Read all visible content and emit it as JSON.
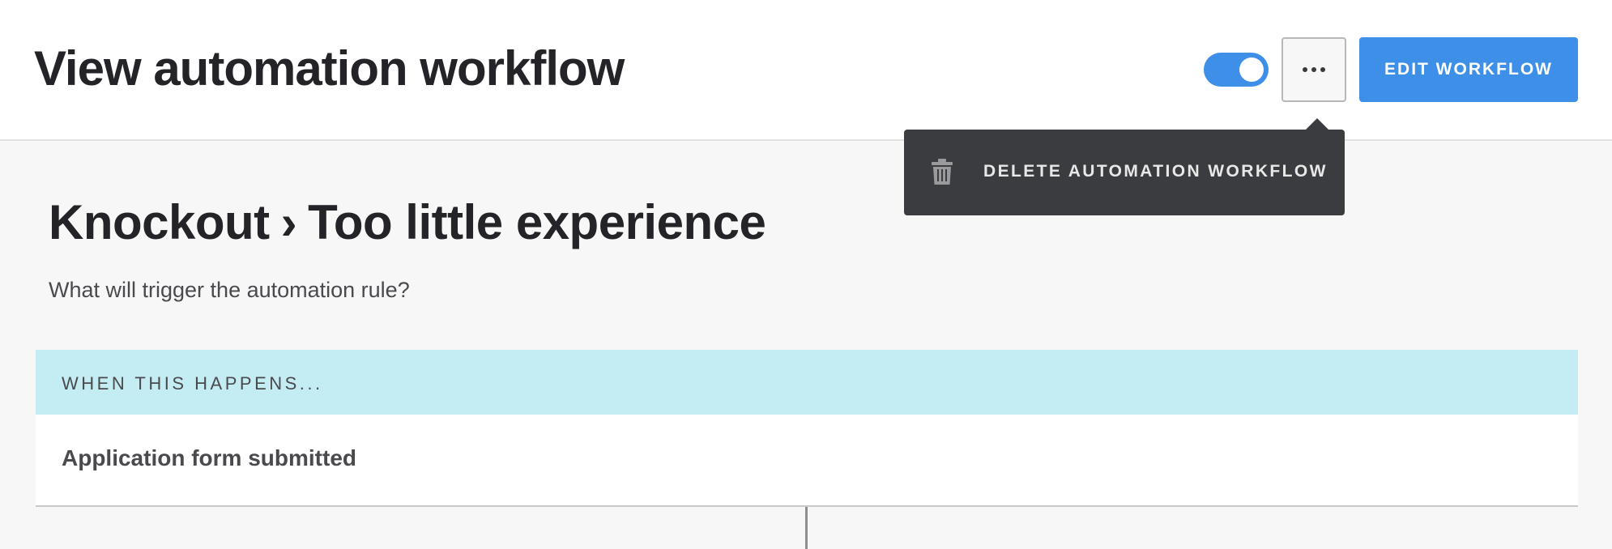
{
  "header": {
    "title": "View automation workflow",
    "toggle": {
      "enabled": true,
      "accent_color": "#3d8fe8"
    },
    "more_button_icon": "more-horizontal-icon",
    "edit_button_label": "EDIT WORKFLOW"
  },
  "menu": {
    "items": [
      {
        "icon": "trash-icon",
        "label": "DELETE AUTOMATION WORKFLOW"
      }
    ]
  },
  "rule": {
    "breadcrumb": [
      "Knockout",
      "Too little experience"
    ],
    "separator": "›",
    "subtitle": "What will trigger the automation rule?"
  },
  "trigger": {
    "header_label": "WHEN THIS HAPPENS...",
    "value": "Application form submitted",
    "header_color": "#c4edf3"
  }
}
